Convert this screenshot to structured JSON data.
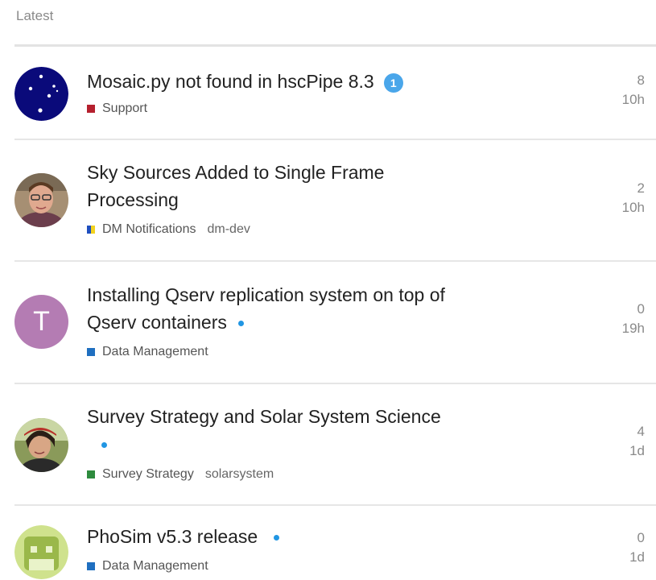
{
  "section": {
    "title": "Latest"
  },
  "topics": [
    {
      "title": "Mosaic.py not found in hscPipe 8.3",
      "badge": "1",
      "category": {
        "name": "Support",
        "color": "#b5202e"
      },
      "tags": [],
      "replies": "8",
      "age": "10h",
      "avatar": "navy-stars"
    },
    {
      "title": "Sky Sources Added to Single Frame Processing",
      "category": {
        "name": "DM Notifications",
        "color": "#1f4fbf",
        "color2": "#f2d21f"
      },
      "tags": [
        "dm-dev"
      ],
      "replies": "2",
      "age": "10h",
      "avatar": "photo-man-glasses"
    },
    {
      "title": "Installing Qserv replication system on top of Qserv containers",
      "category": {
        "name": "Data Management",
        "color": "#1f6fc0"
      },
      "tags": [],
      "replies": "0",
      "age": "19h",
      "avatar": "letter",
      "avatar_letter": "T",
      "avatar_color": "#b47cb3"
    },
    {
      "title": "Survey Strategy and Solar System Science",
      "category": {
        "name": "Survey Strategy",
        "color": "#2e8b3e"
      },
      "tags": [
        "solarsystem"
      ],
      "replies": "4",
      "age": "1d",
      "avatar": "photo-woman"
    },
    {
      "title": "PhoSim v5.3 release",
      "category": {
        "name": "Data Management",
        "color": "#1f6fc0"
      },
      "tags": [],
      "replies": "0",
      "age": "1d",
      "avatar": "green-robot"
    }
  ]
}
